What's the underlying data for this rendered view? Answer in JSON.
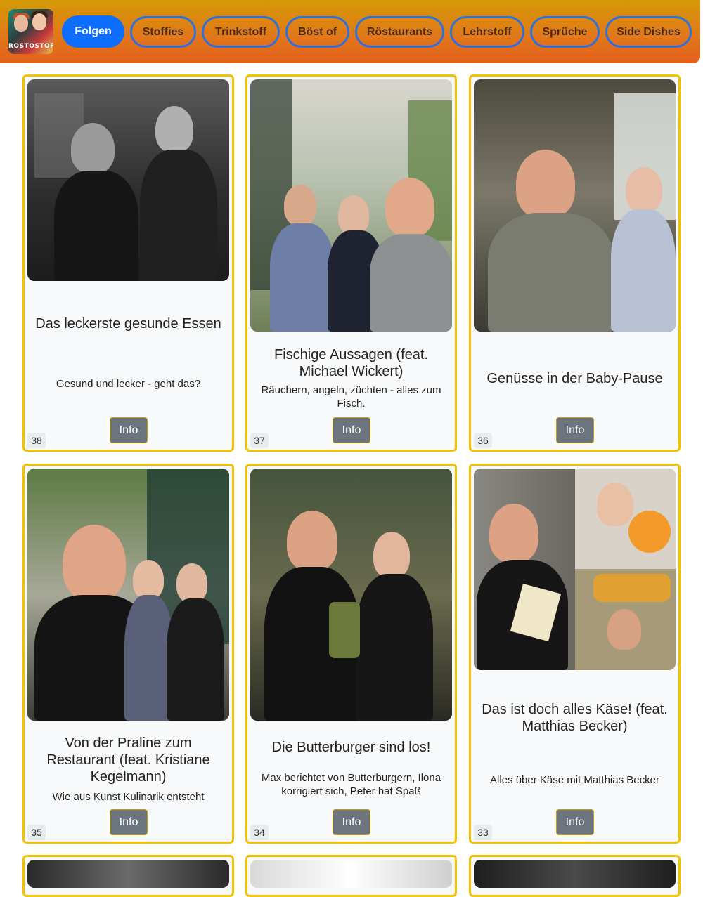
{
  "nav": {
    "logo_text": "ROSTOSTOFF",
    "items": [
      {
        "label": "Folgen",
        "active": true
      },
      {
        "label": "Stoffies",
        "active": false
      },
      {
        "label": "Trinkstoff",
        "active": false
      },
      {
        "label": "Böst of",
        "active": false
      },
      {
        "label": "Röstaurants",
        "active": false
      },
      {
        "label": "Lehrstoff",
        "active": false
      },
      {
        "label": "Sprüche",
        "active": false
      },
      {
        "label": "Side Dishes",
        "active": false
      }
    ]
  },
  "episodes": [
    {
      "number": "38",
      "title": "Das leckerste gesunde Essen",
      "description": "Gesund und lecker - geht das?",
      "button": "Info"
    },
    {
      "number": "37",
      "title": "Fischige Aussagen (feat. Michael Wickert)",
      "description": "Räuchern, angeln, züchten - alles zum Fisch.",
      "button": "Info"
    },
    {
      "number": "36",
      "title": "Genüsse in der Baby-Pause",
      "description": "",
      "button": "Info"
    },
    {
      "number": "35",
      "title": "Von der Praline zum Restaurant (feat. Kristiane Kegelmann)",
      "description": "Wie aus Kunst Kulinarik entsteht",
      "button": "Info"
    },
    {
      "number": "34",
      "title": "Die Butterburger sind los!",
      "description": "Max berichtet von Butterburgern, Ilona korrigiert sich, Peter hat Spaß",
      "button": "Info"
    },
    {
      "number": "33",
      "title": "Das ist doch alles Käse! (feat. Matthias Becker)",
      "description": "Alles über Käse mit Matthias Becker",
      "button": "Info"
    }
  ]
}
